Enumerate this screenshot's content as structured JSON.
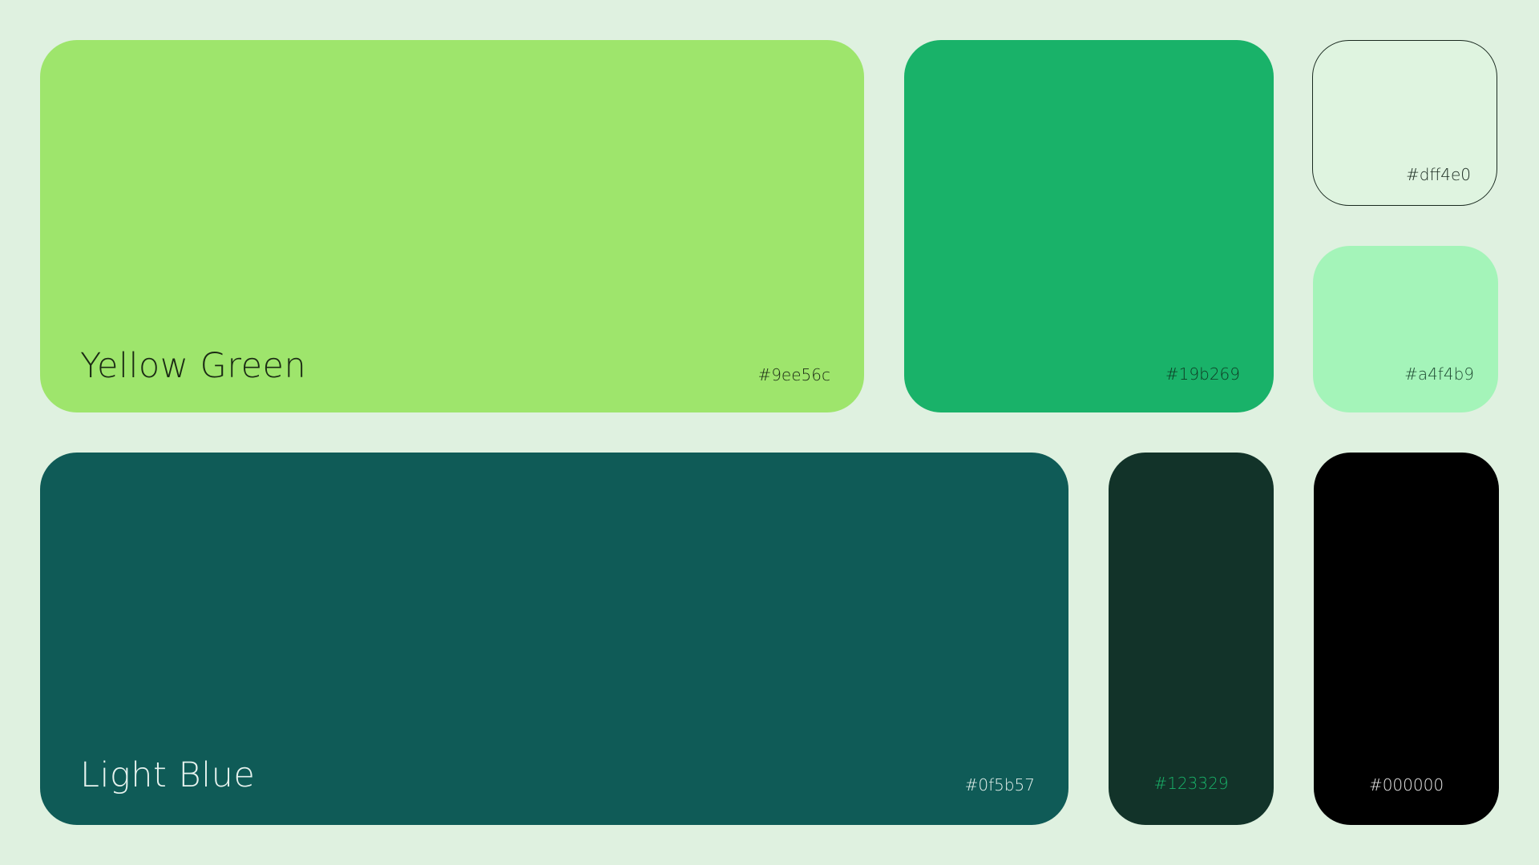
{
  "background_color": "#dff1e0",
  "swatches": {
    "yellow_green": {
      "name": "Yellow Green",
      "hex": "#9ee56c",
      "fill": "#9ee56c",
      "text_color": "#1b2a14"
    },
    "green": {
      "hex": "#19b269",
      "fill": "#19b269",
      "text_color": "#0f3a24"
    },
    "mint_white": {
      "hex": "#dff4e0",
      "fill": "#dff4e0",
      "text_color": "#1a2a20"
    },
    "mint": {
      "hex": "#a4f4b9",
      "fill": "#a4f4b9",
      "text_color": "#1f4a32"
    },
    "light_blue": {
      "name": "Light Blue",
      "hex": "#0f5b57",
      "fill": "#0f5b57",
      "text_color": "#e6f2ee"
    },
    "dark_green": {
      "hex": "#123329",
      "fill": "#123329",
      "text_color": "#19b269"
    },
    "black": {
      "hex": "#000000",
      "fill": "#000000",
      "text_color": "#e8e8e8"
    }
  }
}
